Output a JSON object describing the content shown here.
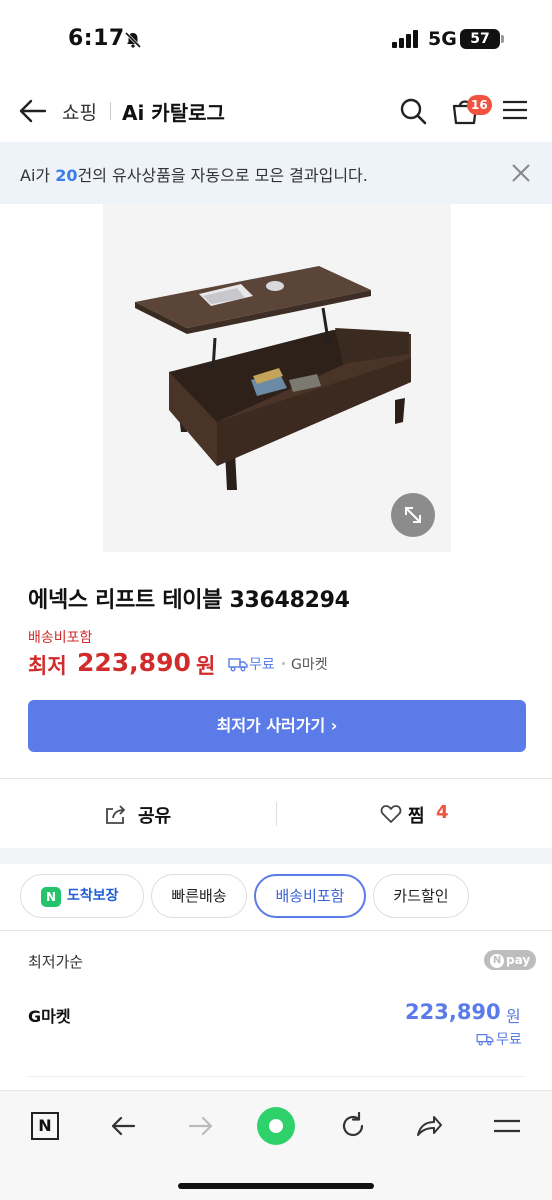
{
  "status_bar": {
    "time": "6:17",
    "network": "5G",
    "battery": "57"
  },
  "header": {
    "back_icon": "arrow-left-icon",
    "shopping": "쇼핑",
    "ai_catalog": "Ai 카탈로그",
    "cart_count": "16"
  },
  "notice": {
    "prefix": "Ai가 ",
    "count": "20",
    "suffix": "건의 유사상품을 자동으로 모은 결과입니다."
  },
  "product": {
    "title": "에넥스 리프트 테이블 33648294",
    "shipping_included": "배송비포함",
    "lowest_label": "최저",
    "price": "223,890",
    "price_unit": "원",
    "free_shipping": "무료",
    "seller": "G마켓",
    "buy_button": "최저가 사러가기 ›"
  },
  "actions": {
    "share": "공유",
    "like": "찜",
    "like_count": "4"
  },
  "filters": [
    {
      "label": "도착보장",
      "badge": "N"
    },
    {
      "label": "빠른배송"
    },
    {
      "label": "배송비포함",
      "selected": true
    },
    {
      "label": "카드할인"
    }
  ],
  "listing": {
    "sort": "최저가순",
    "npay": "pay",
    "rows": [
      {
        "seller": "G마켓",
        "price": "223,890",
        "unit": "원",
        "shipping": "무료"
      }
    ]
  },
  "browser_bar": {
    "n_label": "N"
  },
  "colors": {
    "accent": "#5b7ce8",
    "price_red": "#d12c2c",
    "badge": "#f0533e",
    "notice_bg": "#eef2f9"
  }
}
